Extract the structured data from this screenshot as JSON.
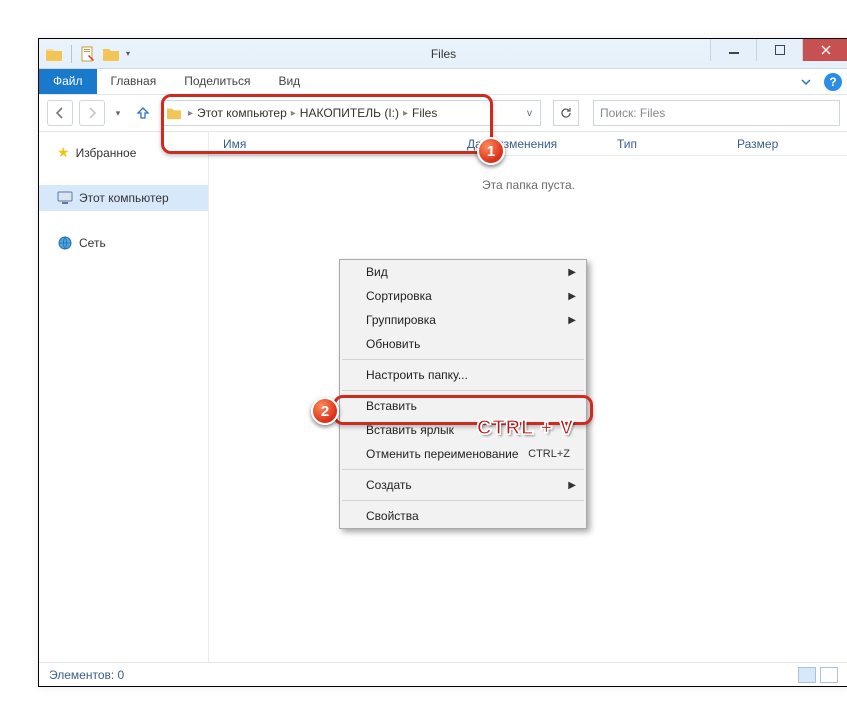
{
  "titlebar": {
    "title": "Files"
  },
  "ribbon": {
    "file": "Файл",
    "tabs": [
      "Главная",
      "Поделиться",
      "Вид"
    ]
  },
  "breadcrumb": {
    "items": [
      "Этот компьютер",
      "НАКОПИТЕЛЬ (I:)",
      "Files"
    ]
  },
  "search": {
    "placeholder": "Поиск: Files"
  },
  "sidebar": {
    "favorites": "Избранное",
    "this_pc": "Этот компьютер",
    "network": "Сеть"
  },
  "columns": {
    "name": "Имя",
    "date": "Дата изменения",
    "type": "Тип",
    "size": "Размер"
  },
  "empty": "Эта папка пуста.",
  "statusbar": {
    "elements": "Элементов: 0"
  },
  "context_menu": {
    "view": "Вид",
    "sort": "Сортировка",
    "group": "Группировка",
    "refresh": "Обновить",
    "customize": "Настроить папку...",
    "paste": "Вставить",
    "paste_shortcut": "Вставить ярлык",
    "undo_rename": "Отменить переименование",
    "undo_shortcut": "CTRL+Z",
    "new": "Создать",
    "properties": "Свойства"
  },
  "annotations": {
    "marker1": "1",
    "marker2": "2",
    "ctrlv": "CTRL + V"
  }
}
